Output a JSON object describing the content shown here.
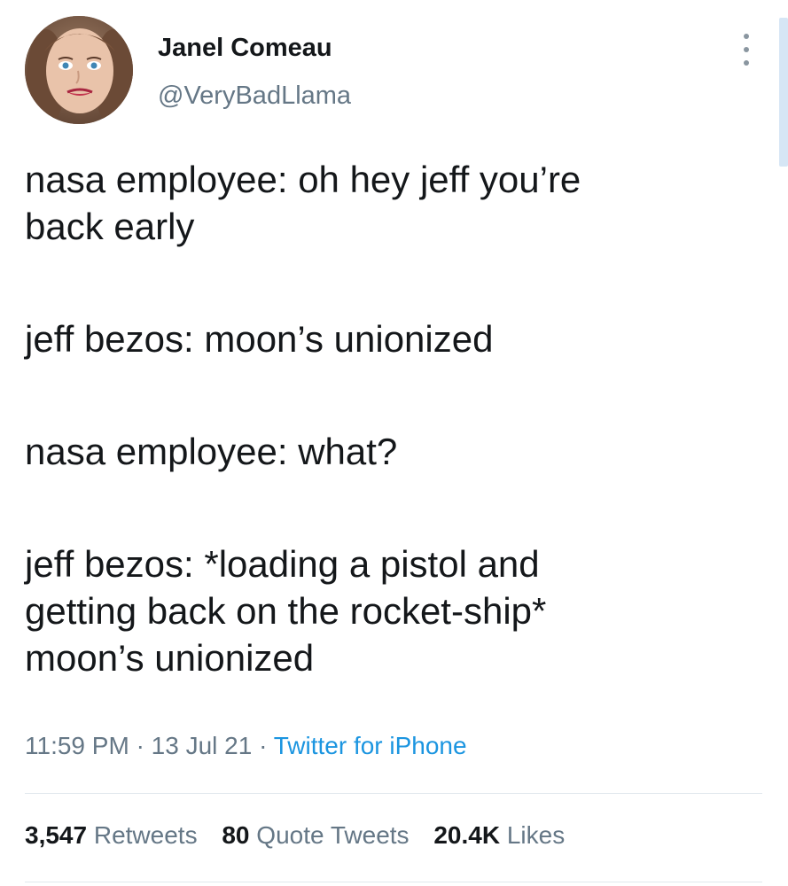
{
  "author": {
    "display_name": "Janel Comeau",
    "handle": "@VeryBadLlama",
    "avatar_icon": "profile-photo"
  },
  "tweet": {
    "lines": [
      "nasa employee: oh hey jeff you’re",
      "back early",
      "jeff bezos: moon’s unionized",
      "nasa employee: what?",
      "jeff bezos: *loading a pistol and",
      "getting back on the rocket-ship*",
      "moon’s unionized"
    ]
  },
  "meta": {
    "time": "11:59 PM",
    "separator": "·",
    "date": "13 Jul 21",
    "source": "Twitter for iPhone"
  },
  "stats": {
    "retweets_count": "3,547",
    "retweets_label": "Retweets",
    "quotes_count": "80",
    "quotes_label": "Quote Tweets",
    "likes_count": "20.4K",
    "likes_label": "Likes"
  },
  "colors": {
    "text": "#14171a",
    "secondary": "#657786",
    "link": "#1b95e0",
    "divider": "#e1e8ed"
  }
}
